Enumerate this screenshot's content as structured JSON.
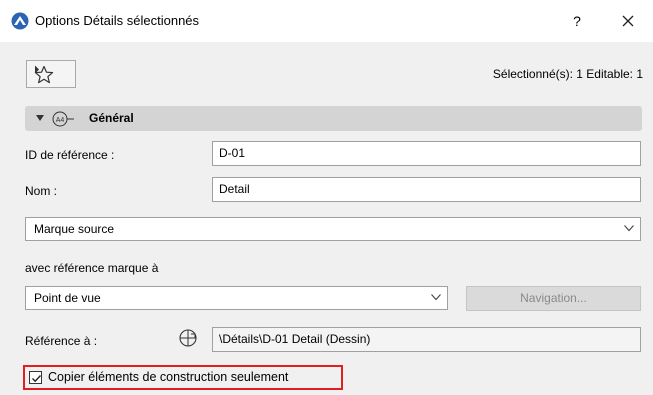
{
  "window": {
    "title": "Options Détails sélectionnés",
    "help_label": "?",
    "close_icon": "close-icon",
    "app_icon": "archicad-icon"
  },
  "toolbar": {
    "favorites_icon": "star-icon",
    "selection_info": "Sélectionné(s): 1 Editable: 1"
  },
  "section": {
    "title": "Général",
    "icon": "detail-marker-a4-icon",
    "expanded": true
  },
  "fields": {
    "ref_id_label": "ID de référence :",
    "ref_id_value": "D-01",
    "name_label": "Nom :",
    "name_value": "Detail",
    "marker_dropdown": "Marque source",
    "marker_ref_label": "avec référence marque à",
    "viewpoint_dropdown": "Point de vue",
    "navigation_button": "Navigation...",
    "reference_label": "Référence à :",
    "reference_value": "\\Détails\\D-01 Detail (Dessin)",
    "copy_checkbox_label": "Copier éléments de construction seulement",
    "copy_checkbox_checked": true
  },
  "colors": {
    "highlight_border": "#e02020",
    "section_header_bg": "#d4d4d4",
    "app_icon_blue": "#2c64b4"
  }
}
